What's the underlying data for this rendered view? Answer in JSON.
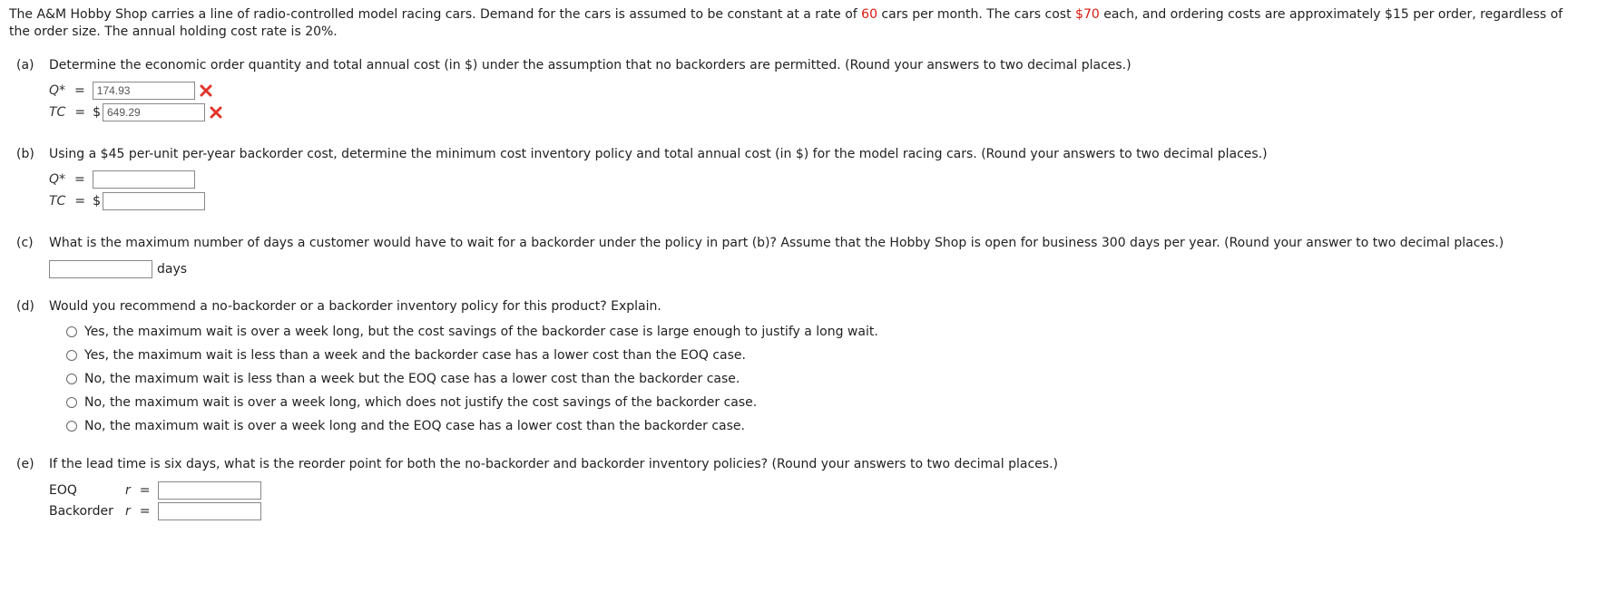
{
  "intro": {
    "t1": "The A&M Hobby Shop carries a line of radio-controlled model racing cars. Demand for the cars is assumed to be constant at a rate of ",
    "demand": "60",
    "t2": " cars per month. The cars cost ",
    "cost": "$70",
    "t3": " each, and ordering costs are approximately $15 per order, regardless of the order size. The annual holding cost rate is 20%."
  },
  "part_a": {
    "label": "(a)",
    "question": "Determine the economic order quantity and total annual cost (in $) under the assumption that no backorders are permitted. (Round your answers to two decimal places.)",
    "q_var": "Q*",
    "q_eq": "=",
    "q_value": "174.93",
    "tc_var": "TC",
    "tc_eq": "=",
    "tc_dollar": "$",
    "tc_value": "649.29"
  },
  "part_b": {
    "label": "(b)",
    "question": "Using a $45 per-unit per-year backorder cost, determine the minimum cost inventory policy and total annual cost (in $) for the model racing cars. (Round your answers to two decimal places.)",
    "q_var": "Q*",
    "q_eq": "=",
    "q_value": "",
    "tc_var": "TC",
    "tc_eq": "=",
    "tc_dollar": "$",
    "tc_value": ""
  },
  "part_c": {
    "label": "(c)",
    "question": "What is the maximum number of days a customer would have to wait for a backorder under the policy in part (b)? Assume that the Hobby Shop is open for business 300 days per year. (Round your answer to two decimal places.)",
    "value": "",
    "unit": "days"
  },
  "part_d": {
    "label": "(d)",
    "question": "Would you recommend a no-backorder or a backorder inventory policy for this product? Explain.",
    "options": [
      "Yes, the maximum wait is over a week long, but the cost savings of the backorder case is large enough to justify a long wait.",
      "Yes, the maximum wait is less than a week and the backorder case has a lower cost than the EOQ case.",
      "No, the maximum wait is less than a week but the EOQ case has a lower cost than the backorder case.",
      "No, the maximum wait is over a week long, which does not justify the cost savings of the backorder case.",
      "No, the maximum wait is over a week long and the EOQ case has a lower cost than the backorder case."
    ]
  },
  "part_e": {
    "label": "(e)",
    "question": "If the lead time is six days, what is the reorder point for both the no-backorder and backorder inventory policies? (Round your answers to two decimal places.)",
    "eoq_label": "EOQ",
    "backorder_label": "Backorder",
    "r_var": "r",
    "r_eq": "=",
    "eoq_value": "",
    "backorder_value": ""
  },
  "icons": {
    "wrong_mark": "red-x-icon",
    "wrong_color": "#e0352b"
  }
}
